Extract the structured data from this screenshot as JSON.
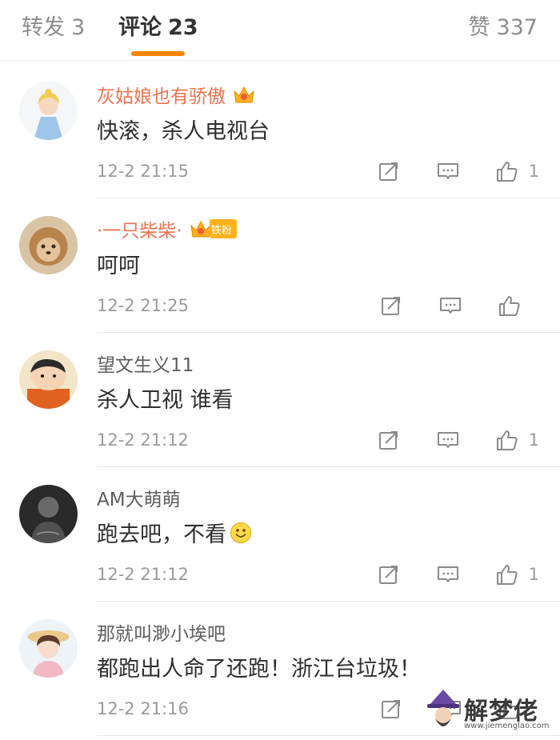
{
  "tabs": [
    {
      "label": "转发",
      "count": "3"
    },
    {
      "label": "评论",
      "count": "23"
    },
    {
      "label": "赞",
      "count": "337"
    }
  ],
  "comments": [
    {
      "username": "灰姑娘也有骄傲",
      "text": "快滚，杀人电视台",
      "time": "12-2 21:15",
      "likes": "1",
      "badge": "crown",
      "emoji": ""
    },
    {
      "username": "·一只柴柴·",
      "text": "呵呵",
      "time": "12-2 21:25",
      "likes": "",
      "badge": "crown-fan",
      "fan_label": "铁粉",
      "emoji": ""
    },
    {
      "username": "望文生义11",
      "text": "杀人卫视 谁看",
      "time": "12-2 21:12",
      "likes": "1",
      "badge": "",
      "emoji": ""
    },
    {
      "username": "AM大萌萌",
      "text": "跑去吧，不看",
      "time": "12-2 21:12",
      "likes": "1",
      "badge": "",
      "emoji": "smile"
    },
    {
      "username": "那就叫渺小埃吧",
      "text": "都跑出人命了还跑！浙江台垃圾！",
      "time": "12-2 21:16",
      "likes": "",
      "badge": "",
      "emoji": ""
    }
  ],
  "icons": {
    "repost": "repost-icon",
    "comment": "comment-icon",
    "like": "thumbs-up-icon"
  },
  "colors": {
    "accent": "#ff8200",
    "username_vip": "#eb7350",
    "username_plain": "#5d5d5d",
    "badge": "#ffb11b"
  },
  "watermark": {
    "text": "解梦佬",
    "url": "www.jiemenglao.com"
  }
}
